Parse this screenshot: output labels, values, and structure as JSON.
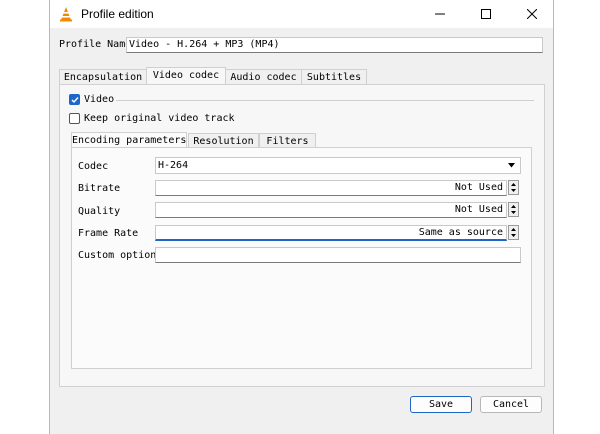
{
  "window": {
    "title": "Profile edition"
  },
  "profile": {
    "name_label": "Profile Name",
    "name_value": "Video - H.264 + MP3 (MP4)"
  },
  "tabs": [
    {
      "label": "Encapsulation"
    },
    {
      "label": "Video codec"
    },
    {
      "label": "Audio codec"
    },
    {
      "label": "Subtitles"
    }
  ],
  "video": {
    "video_checkbox_label": "Video",
    "video_checked": true,
    "keep_original_label": "Keep original video track",
    "keep_original_checked": false
  },
  "subtabs": [
    {
      "label": "Encoding parameters"
    },
    {
      "label": "Resolution"
    },
    {
      "label": "Filters"
    }
  ],
  "encoding": {
    "codec_label": "Codec",
    "codec_value": "H-264",
    "bitrate_label": "Bitrate",
    "bitrate_value": "Not Used",
    "quality_label": "Quality",
    "quality_value": "Not Used",
    "framerate_label": "Frame Rate",
    "framerate_value": "Same as source",
    "custom_label": "Custom options",
    "custom_value": ""
  },
  "buttons": {
    "save": "Save",
    "cancel": "Cancel"
  },
  "colors": {
    "accent": "#1f66c9",
    "cone_orange": "#f08a00"
  }
}
